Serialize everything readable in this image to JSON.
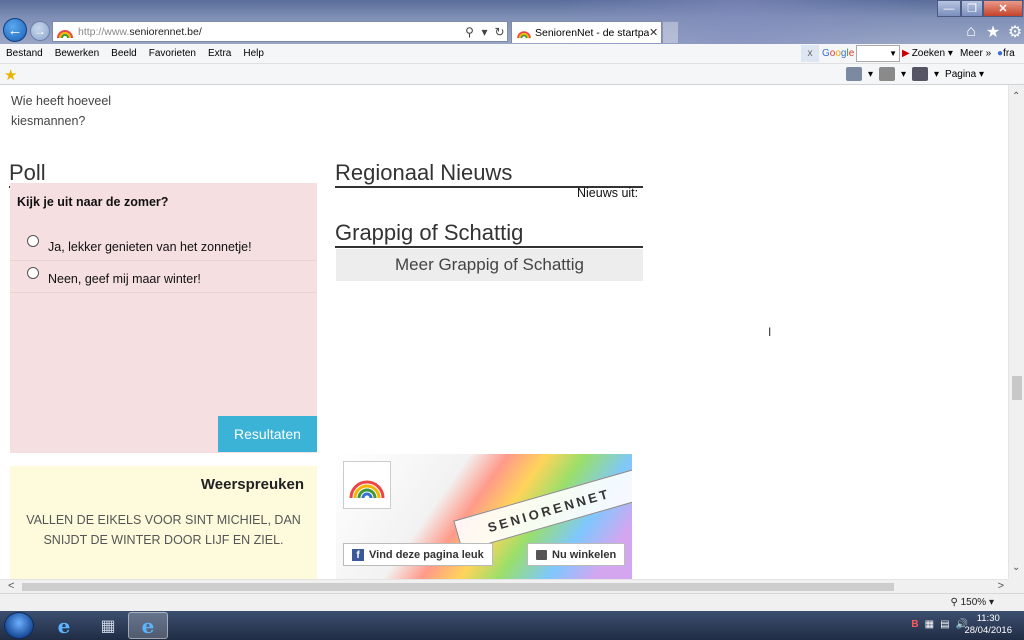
{
  "browser": {
    "url_prefix": "http://www.",
    "url_domain": "seniorennet.be/",
    "tab_title": "SeniorenNet - de startpagin...",
    "menu": [
      "Bestand",
      "Bewerken",
      "Beeld",
      "Favorieten",
      "Extra",
      "Help"
    ],
    "toolbar": {
      "google_close": "x",
      "google_label": [
        "G",
        "o",
        "o",
        "g",
        "l",
        "e"
      ],
      "search_button": "Zoeken",
      "more": "Meer",
      "user": "fra",
      "page_menu": "Pagina"
    },
    "zoom": "150%"
  },
  "page": {
    "intro_line1": "Wie heeft hoeveel",
    "intro_line2": "kiesmannen?",
    "poll": {
      "title": "Poll",
      "question": "Kijk je uit naar de zomer?",
      "options": [
        "Ja, lekker genieten van het zonnetje!",
        "Neen, geef mij maar winter!"
      ],
      "results_button": "Resultaten"
    },
    "regional": {
      "title": "Regionaal Nieuws",
      "news_from": "Nieuws uit:"
    },
    "funny": {
      "title": "Grappig of Schattig",
      "more_button": "Meer Grappig of Schattig"
    },
    "weather": {
      "title": "Weerspreuken",
      "text": "VALLEN DE EIKELS VOOR SINT MICHIEL, DAN SNIJDT DE WINTER DOOR LIJF EN ZIEL."
    },
    "facebook": {
      "cube_text": "SENIORENNET",
      "like_button": "Vind deze pagina leuk",
      "shop_button": "Nu winkelen"
    }
  },
  "taskbar": {
    "tray_badge": "B",
    "time": "11:30",
    "date": "28/04/2016"
  }
}
